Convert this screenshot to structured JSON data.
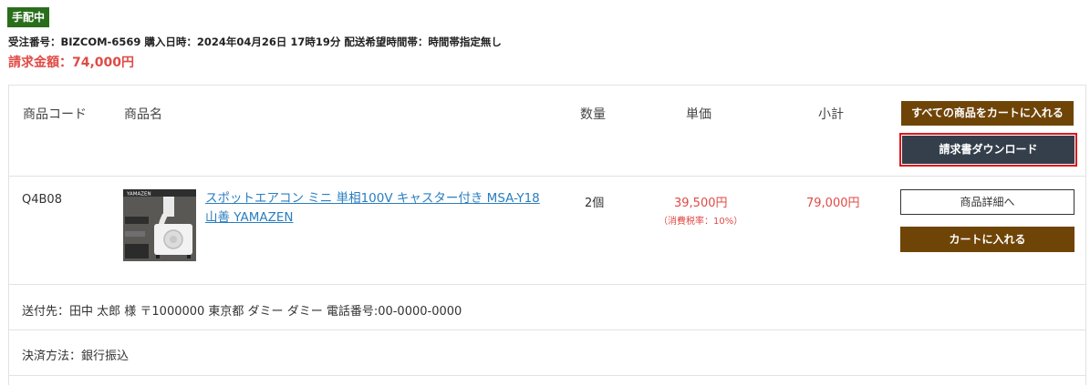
{
  "order": {
    "status": "手配中",
    "meta": "受注番号：BIZCOM-6569 購入日時：2024年04月26日 17時19分 配送希望時間帯：時間帯指定無し",
    "total": "請求金額：74,000円"
  },
  "table": {
    "headers": {
      "code": "商品コード",
      "name": "商品名",
      "qty": "数量",
      "unit_price": "単価",
      "subtotal": "小計"
    },
    "add_all_label": "すべての商品をカートに入れる",
    "invoice_download_label": "請求書ダウンロード"
  },
  "items": [
    {
      "code": "Q4B08",
      "name": "スポットエアコン ミニ 単相100V キャスター付き MSA-Y18 山善 YAMAZEN",
      "qty": "2個",
      "unit_price": "39,500円",
      "tax_note": "（消費税率：10%）",
      "subtotal": "79,000円",
      "detail_label": "商品詳細へ",
      "add_to_cart_label": "カートに入れる",
      "thumb_brand": "YAMAZEN"
    }
  ],
  "shipping": {
    "text": "送付先：田中 太郎 様 〒1000000 東京都 ダミー ダミー 電話番号:00-0000-0000"
  },
  "payment": {
    "text": "決済方法：銀行振込"
  },
  "colors": {
    "status_green": "#2a6e1c",
    "price_red": "#e04a45",
    "button_brown": "#6f4407",
    "button_dark": "#343f4b",
    "link_blue": "#2a7ec0",
    "highlight_red": "#e0141b"
  }
}
